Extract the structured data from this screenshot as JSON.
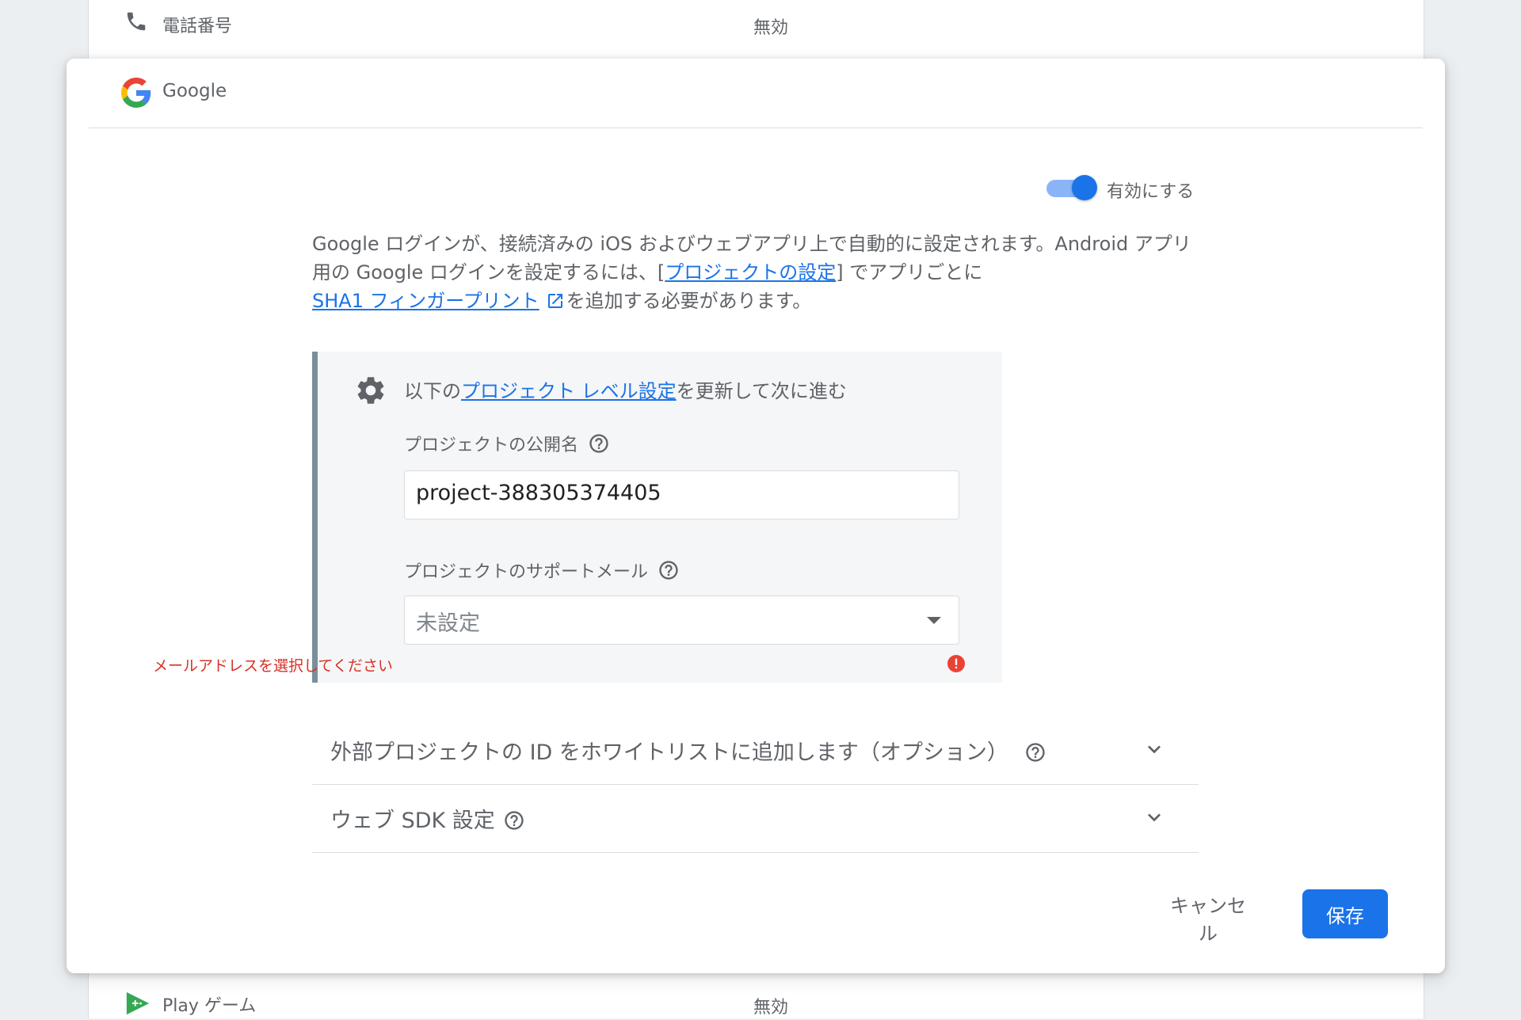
{
  "background_rows": {
    "phone": {
      "name": "電話番号",
      "status": "無効"
    },
    "play_games": {
      "name": "Play ゲーム",
      "status": "無効"
    }
  },
  "dialog": {
    "provider_title": "Google",
    "toggle": {
      "label": "有効にする",
      "enabled": true
    },
    "description": {
      "part1": "Google ログインが、接続済みの iOS およびウェブアプリ上で自動的に設定されます。Android アプリ用の Google ログインを設定するには、[",
      "project_settings_link": "プロジェクトの設定",
      "part2": "] でアプリごとに",
      "sha1_link": "SHA1 フィンガープリント",
      "part3": "を追加する必要があります。"
    },
    "project_panel": {
      "heading_pre": "以下の",
      "heading_link": "プロジェクト レベル設定",
      "heading_post": "を更新して次に進む",
      "public_name_label": "プロジェクトの公開名",
      "public_name_value": "project-388305374405",
      "support_email_label": "プロジェクトのサポートメール",
      "support_email_value": "未設定",
      "support_email_error": "メールアドレスを選択してください"
    },
    "accordions": [
      {
        "title": "外部プロジェクトの ID をホワイトリストに追加します（オプション）"
      },
      {
        "title": "ウェブ SDK 設定"
      }
    ],
    "actions": {
      "cancel_label": "キャンセル",
      "save_label": "保存"
    }
  },
  "colors": {
    "accent": "#1a73e8",
    "error": "#d93025",
    "panel_bar": "#78909c"
  }
}
